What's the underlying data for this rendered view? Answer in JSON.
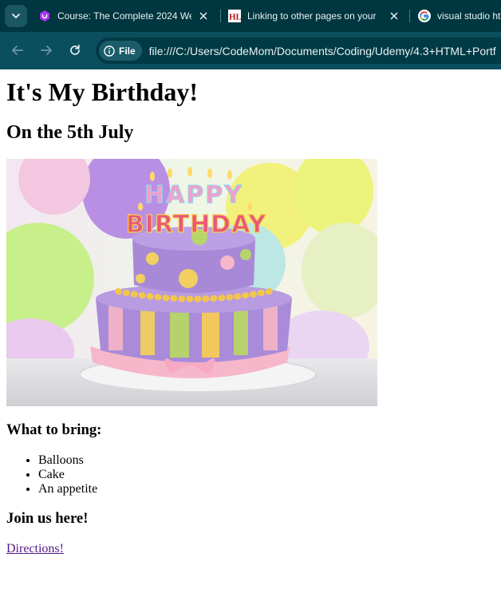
{
  "browser": {
    "tabs": [
      {
        "title": "Course: The Complete 2024 Web",
        "favicon": "udemy-icon"
      },
      {
        "title": "Linking to other pages on your",
        "favicon": "hl-icon"
      },
      {
        "title": "visual studio htt",
        "favicon": "google-icon"
      }
    ],
    "site_chip": "File",
    "url": "file:///C:/Users/CodeMom/Documents/Coding/Udemy/4.3+HTML+Portf",
    "favicon_hl_text": "HL",
    "accent_color": "#0b4f5f",
    "tabstrip_color": "#00363f"
  },
  "page": {
    "title": "It's My Birthday!",
    "subtitle": "On the 5th July",
    "image_text": {
      "line1": "HAPPY",
      "line2": "BIRTHDAY"
    },
    "bring_heading": "What to bring:",
    "bring_items": [
      "Balloons",
      "Cake",
      "An appetite"
    ],
    "join_heading": "Join us here!",
    "link_text": "Directions!",
    "link_color": "#551a8b"
  }
}
